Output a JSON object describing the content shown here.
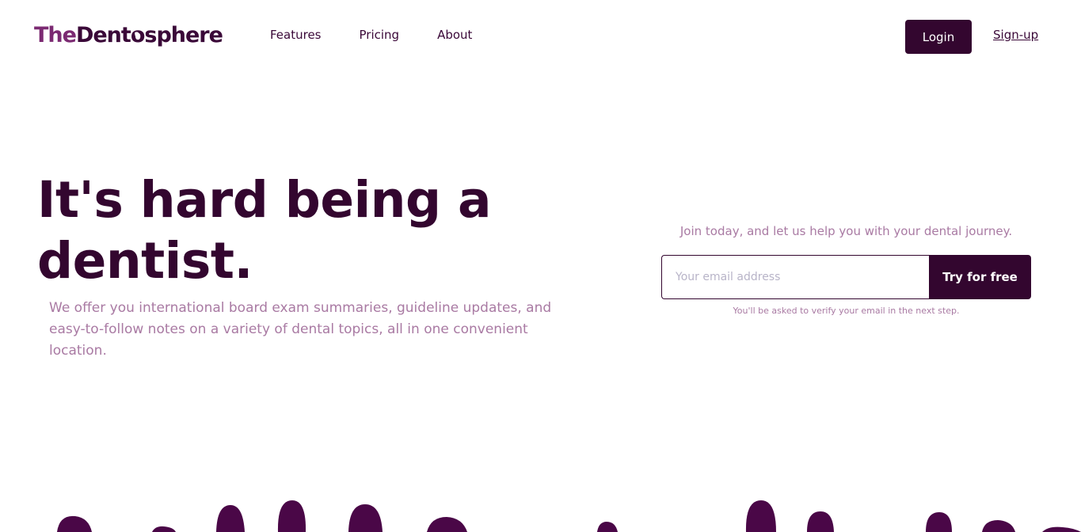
{
  "brand": {
    "part1": "The",
    "part2": "Dent",
    "part3": "sphere"
  },
  "nav": {
    "features": "Features",
    "pricing": "Pricing",
    "about": "About"
  },
  "header": {
    "login_label": "Login",
    "signup_label": "Sign-up"
  },
  "hero": {
    "title": "It's hard being a dentist.",
    "subtitle": "We offer you international board exam summaries, guideline updates, and easy-to-follow notes on a variety of dental topics, all in one convenient location."
  },
  "signup_form": {
    "tagline": "Join today, and let us help you with your dental journey.",
    "email_placeholder": "Your email address",
    "submit_label": "Try for free",
    "note": "You'll be asked to verify your email in the next step."
  },
  "colors": {
    "primary": "#33062f",
    "muted": "#a97aa3",
    "brand_light": "#7b2a72"
  },
  "icons": {
    "logo_o": "tooth-icon",
    "decoration": "teeth-silhouette"
  }
}
